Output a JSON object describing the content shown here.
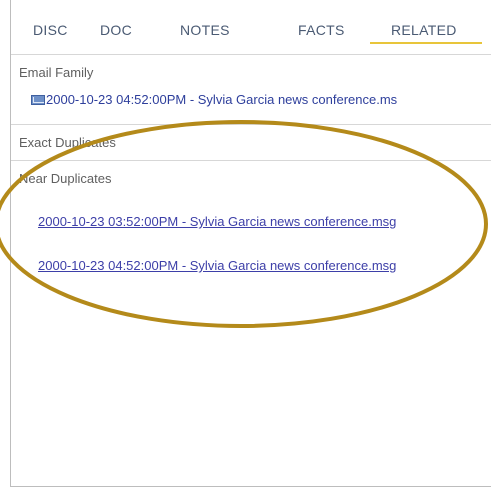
{
  "tabs": [
    "DISC",
    "DOC",
    "NOTES",
    "FACTS",
    "RELATED"
  ],
  "active_tab": "RELATED",
  "accent_color": "#e8c53a",
  "annotation_color": "#b48a1a",
  "sections": {
    "email_family": {
      "title": "Email Family",
      "items": [
        "2000-10-23 04:52:00PM - Sylvia Garcia news conference.ms"
      ]
    },
    "exact_duplicates": {
      "title": "Exact Duplicates"
    },
    "near_duplicates": {
      "title": "Near Duplicates",
      "items": [
        "2000-10-23 03:52:00PM - Sylvia Garcia news conference.msg",
        "2000-10-23 04:52:00PM - Sylvia Garcia news conference.msg"
      ]
    }
  }
}
